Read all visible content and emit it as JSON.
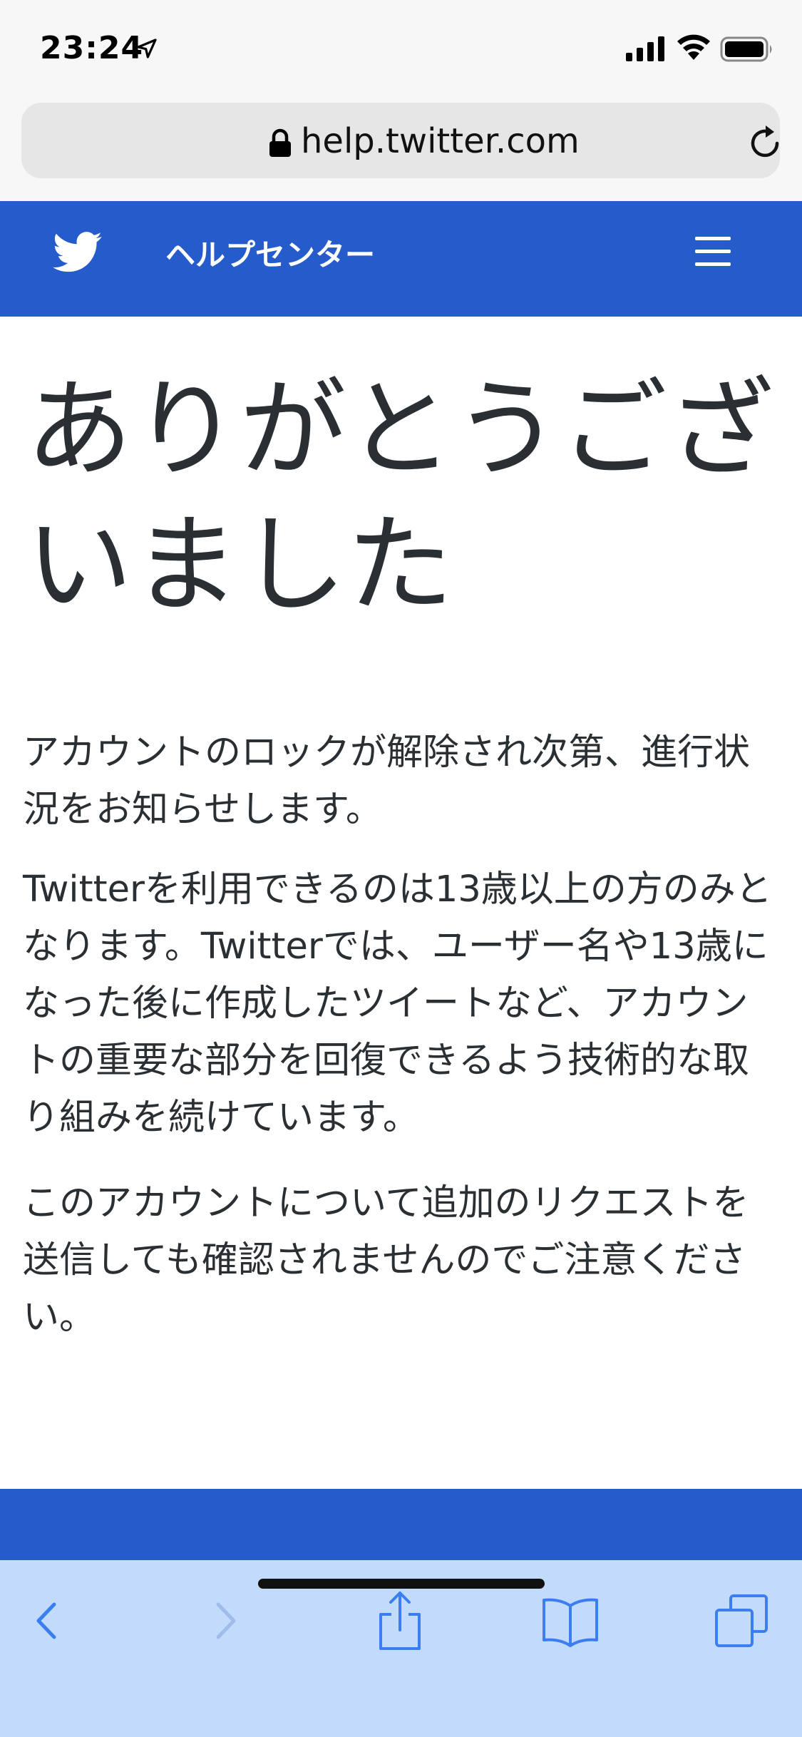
{
  "status_bar": {
    "time": "23:24"
  },
  "url_bar": {
    "url": "help.twitter.com"
  },
  "header": {
    "title": "ヘルプセンター"
  },
  "content": {
    "title": "ありがとうございました",
    "paragraphs": [
      "アカウントのロックが解除され次第、進行状況をお知らせします。",
      "Twitterを利用できるのは13歳以上の方のみとなります。Twitterでは、ユーザー名や13歳になった後に作成したツイートなど、アカウントの重要な部分を回復できるよう技術的な取り組みを続けています。",
      "このアカウントについて追加のリクエストを送信しても確認されませんのでご注意ください。"
    ]
  },
  "colors": {
    "brand_blue": "#255bcb",
    "toolbar_bg": "#c2dbfc",
    "toolbar_icon": "#3a7ef0",
    "text": "#292f33"
  },
  "icons": {
    "status": [
      "location-arrow-icon",
      "signal-icon",
      "wifi-icon",
      "battery-icon"
    ],
    "url_bar": [
      "lock-icon",
      "reload-icon"
    ],
    "header": [
      "twitter-bird-icon",
      "hamburger-menu-icon"
    ],
    "toolbar": [
      "chevron-left-icon",
      "chevron-right-icon",
      "share-icon",
      "book-icon",
      "tabs-icon"
    ]
  }
}
